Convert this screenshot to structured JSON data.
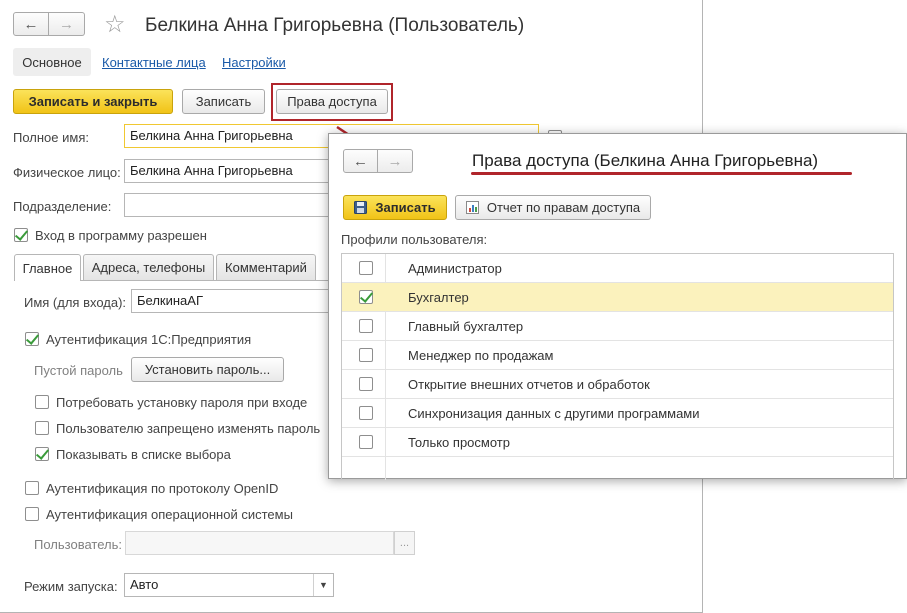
{
  "main": {
    "title": "Белкина Анна Григорьевна (Пользователь)",
    "tabs": {
      "main": "Основное",
      "contacts": "Контактные лица",
      "settings": "Настройки"
    },
    "toolbar": {
      "save_close": "Записать и закрыть",
      "save": "Записать",
      "access_rights": "Права доступа"
    },
    "form": {
      "full_name_label": "Полное имя:",
      "full_name_value": "Белкина Анна Григорьевна",
      "person_label": "Физическое лицо:",
      "person_value": "Белкина Анна Григорьевна",
      "department_label": "Подразделение:",
      "department_value": "",
      "login_allowed": "Вход в программу разрешен"
    },
    "inner_tabs": {
      "main": "Главное",
      "addresses": "Адреса, телефоны",
      "comment": "Комментарий"
    },
    "auth": {
      "login_label": "Имя (для входа):",
      "login_value": "БелкинаАГ",
      "auth_1c": "Аутентификация 1С:Предприятия",
      "empty_password": "Пустой пароль",
      "set_password": "Установить пароль...",
      "require_password_change": "Потребовать установку пароля при входе",
      "deny_password_change": "Пользователю запрещено изменять пароль",
      "show_in_list": "Показывать в списке выбора",
      "auth_openid": "Аутентификация по протоколу OpenID",
      "auth_os": "Аутентификация операционной системы",
      "os_user_label": "Пользователь:",
      "os_user_value": "",
      "launch_mode_label": "Режим запуска:",
      "launch_mode_value": "Авто"
    }
  },
  "popup": {
    "title": "Права доступа (Белкина Анна Григорьевна)",
    "save": "Записать",
    "report": "Отчет по правам доступа",
    "profiles_label": "Профили пользователя:",
    "profiles": [
      {
        "name": "Администратор",
        "checked": false
      },
      {
        "name": "Бухгалтер",
        "checked": true
      },
      {
        "name": "Главный бухгалтер",
        "checked": false
      },
      {
        "name": "Менеджер по продажам",
        "checked": false
      },
      {
        "name": "Открытие внешних отчетов и обработок",
        "checked": false
      },
      {
        "name": "Синхронизация данных с другими программами",
        "checked": false
      },
      {
        "name": "Только просмотр",
        "checked": false
      }
    ]
  },
  "colors": {
    "accent_yellow": "#f4cc2a",
    "highlight_red": "#b0252b",
    "link_blue": "#1a5aa8",
    "selected_row": "#fbf2bd"
  }
}
